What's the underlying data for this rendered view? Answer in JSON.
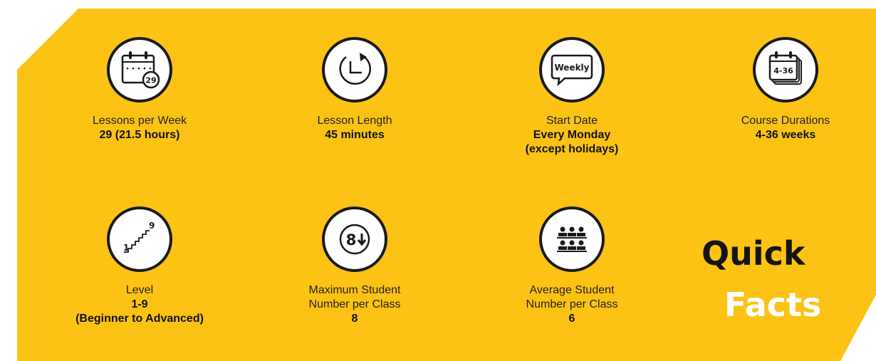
{
  "facts": [
    {
      "icon": "calendar-icon",
      "badge": "29",
      "label": "Lessons per Week",
      "value": [
        "29 (21.5 hours)"
      ]
    },
    {
      "icon": "clock-icon",
      "label": "Lesson Length",
      "value": [
        "45 minutes"
      ]
    },
    {
      "icon": "speech-bubble-icon",
      "badge": "Weekly",
      "label": "Start Date",
      "value": [
        "Every Monday",
        "(except holidays)"
      ]
    },
    {
      "icon": "stacked-calendar-icon",
      "badge": "4-36",
      "label": "Course Durations",
      "value": [
        "4-36 weeks"
      ]
    },
    {
      "icon": "stairs-icon",
      "badge_low": "1",
      "badge_high": "9",
      "label": "Level",
      "value": [
        "1-9",
        "(Beginner to Advanced)"
      ]
    },
    {
      "icon": "max-students-icon",
      "badge": "8",
      "label": "Maximum Student Number per Class",
      "value": [
        "8"
      ]
    },
    {
      "icon": "students-group-icon",
      "label": "Average Student Number per Class",
      "value": [
        "6"
      ]
    }
  ],
  "quick_facts": {
    "word1": "Quick",
    "word2": "Facts"
  },
  "colors": {
    "background": "#fcc314",
    "ink": "#1a1a1a",
    "accent_text": "#ffffff"
  }
}
